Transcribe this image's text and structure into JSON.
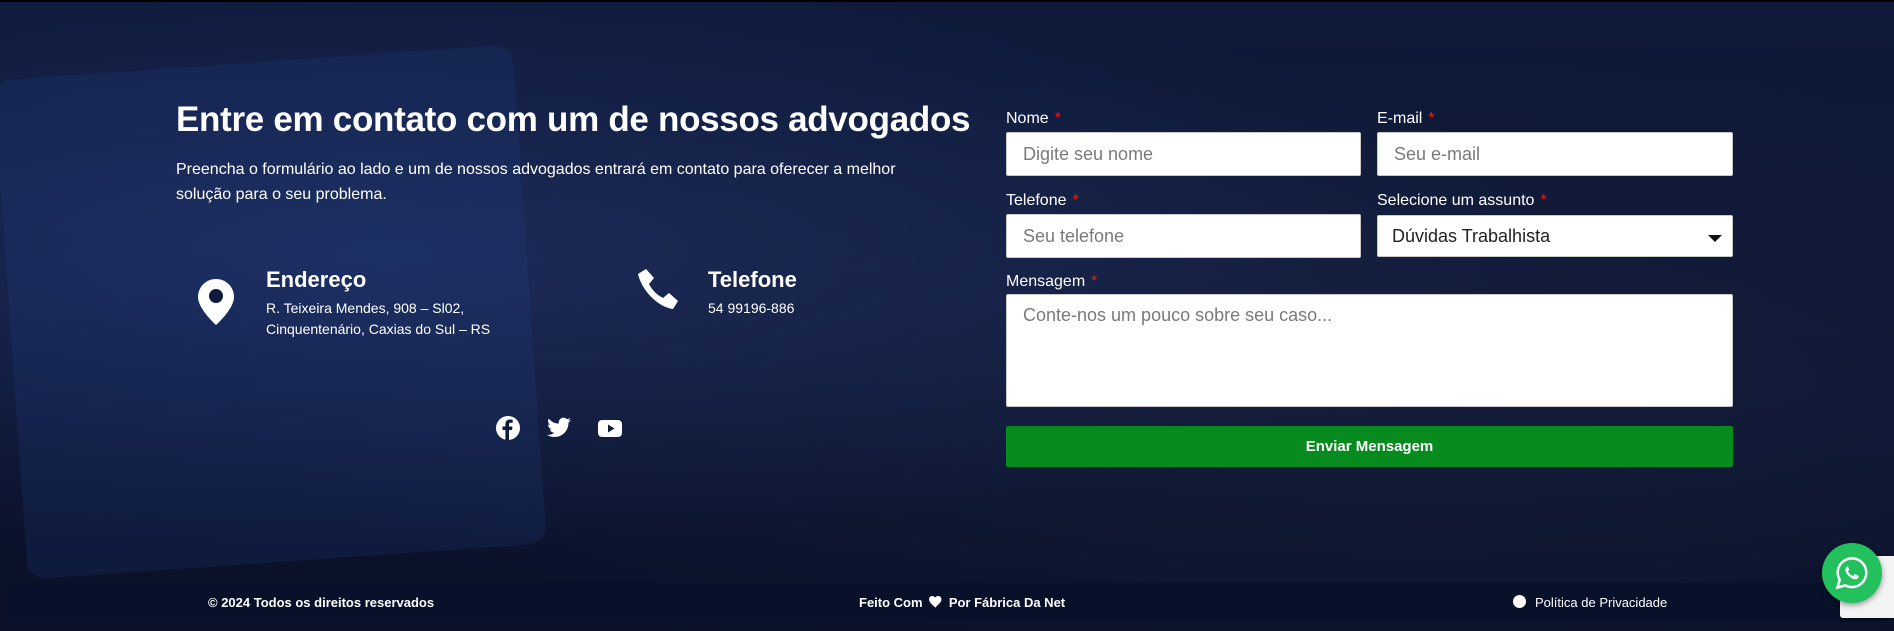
{
  "contact": {
    "title": "Entre em contato com um de nossos advogados",
    "subtitle": "Preencha o formulário ao lado e um de nossos advogados entrará em contato para oferecer a melhor solução para o seu problema.",
    "address": {
      "icon": "map-pin-icon",
      "title": "Endereço",
      "line1": "R. Teixeira Mendes, 908 – Sl02,",
      "line2": "Cinquentenário, Caxias do Sul – RS"
    },
    "phone": {
      "icon": "phone-icon",
      "title": "Telefone",
      "number": "54 99196-886"
    },
    "social": [
      "facebook-icon",
      "twitter-icon",
      "youtube-icon"
    ]
  },
  "form": {
    "name_label": "Nome",
    "name_placeholder": "Digite seu nome",
    "email_label": "E-mail",
    "email_placeholder": "Seu e-mail",
    "phone_label": "Telefone",
    "phone_placeholder": "Seu telefone",
    "subject_label": "Selecione um assunto",
    "subject_value": "Dúvidas Trabalhista",
    "message_label": "Mensagem",
    "message_placeholder": "Conte-nos um pouco sobre seu caso...",
    "required_mark": "*",
    "submit_label": "Enviar Mensagem"
  },
  "footer": {
    "copyright": "© 2024 Todos os direitos reservados",
    "made_with_prefix": "Feito Com",
    "made_with_suffix": "Por Fábrica Da Net",
    "privacy": "Política de Privacidade"
  },
  "colors": {
    "background": "#0d1633",
    "button": "#078a1e",
    "required": "#e02020",
    "whatsapp": "#22c15e"
  }
}
